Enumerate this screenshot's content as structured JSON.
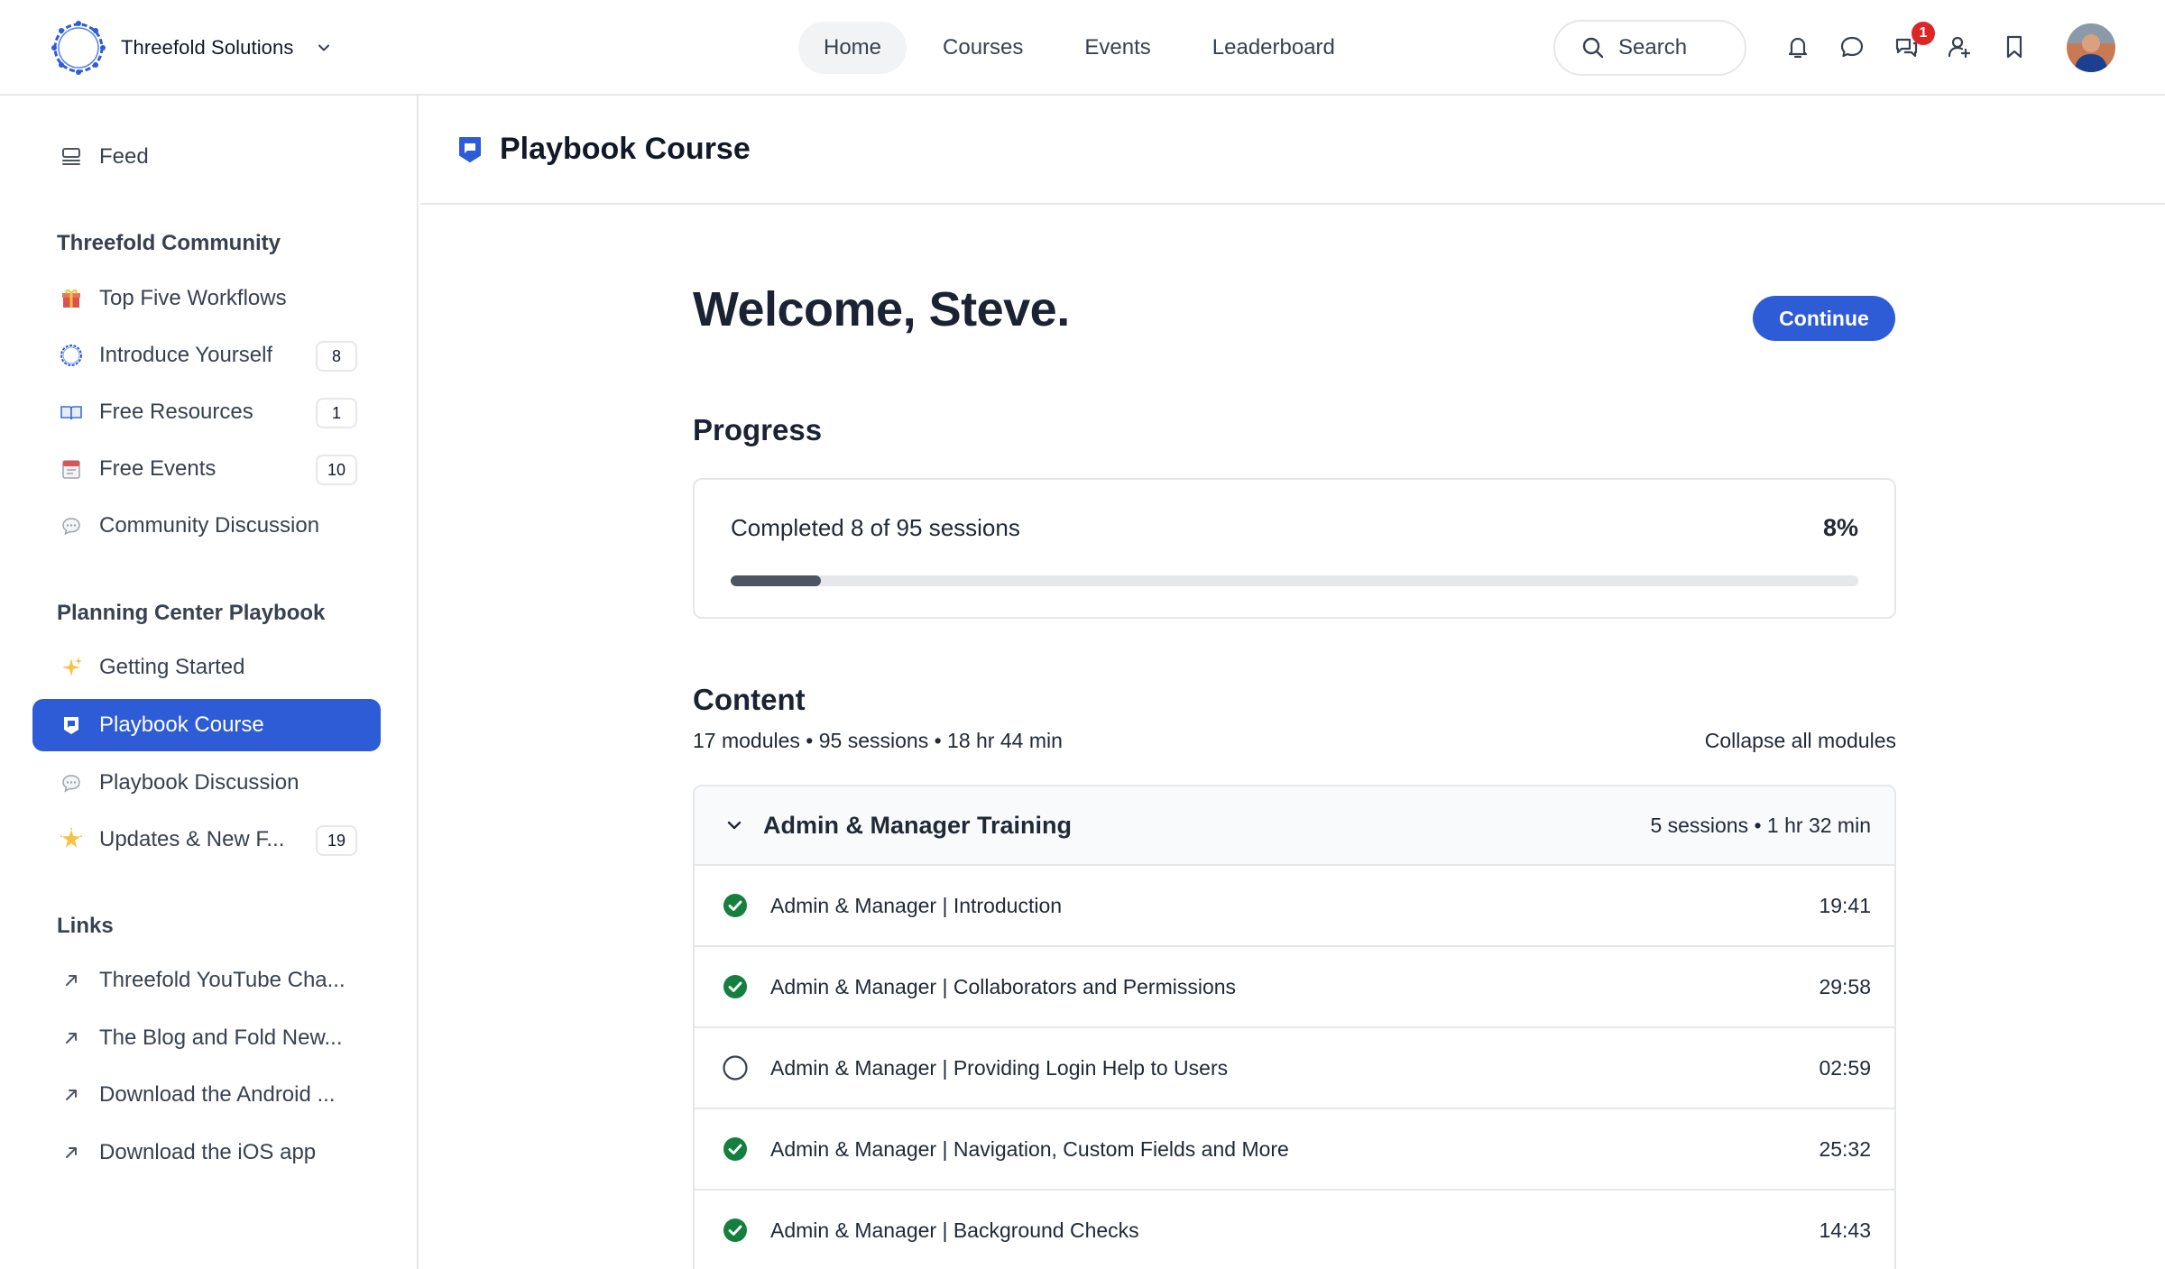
{
  "header": {
    "brand_name": "Threefold Solutions",
    "nav": [
      {
        "label": "Home",
        "active": true
      },
      {
        "label": "Courses",
        "active": false
      },
      {
        "label": "Events",
        "active": false
      },
      {
        "label": "Leaderboard",
        "active": false
      }
    ],
    "search_label": "Search",
    "icons": [
      "bell-icon",
      "chat-icon",
      "messages-icon",
      "people-icon",
      "bookmark-icon"
    ],
    "messages_badge": "1"
  },
  "sidebar": {
    "feed": "Feed",
    "sections": [
      {
        "heading": "Threefold Community",
        "items": [
          {
            "label": "Top Five Workflows",
            "icon": "gift-icon",
            "count": null
          },
          {
            "label": "Introduce Yourself",
            "icon": "threefold-logo-icon",
            "count": "8"
          },
          {
            "label": "Free Resources",
            "icon": "book-icon",
            "count": "1"
          },
          {
            "label": "Free Events",
            "icon": "calendar-icon",
            "count": "10"
          },
          {
            "label": "Community Discussion",
            "icon": "speech-bubble-icon",
            "count": null
          }
        ]
      },
      {
        "heading": "Planning Center Playbook",
        "items": [
          {
            "label": "Getting Started",
            "icon": "sparkles-icon",
            "count": null
          },
          {
            "label": "Playbook Course",
            "icon": "playbook-icon",
            "count": null,
            "active": true
          },
          {
            "label": "Playbook Discussion",
            "icon": "speech-bubble-icon",
            "count": null
          },
          {
            "label": "Updates & New F...",
            "icon": "star-burst-icon",
            "count": "19"
          }
        ]
      },
      {
        "heading": "Links",
        "items": [
          {
            "label": "Threefold YouTube Cha...",
            "icon": "external-arrow-icon"
          },
          {
            "label": "The Blog and Fold New...",
            "icon": "external-arrow-icon"
          },
          {
            "label": "Download the Android ...",
            "icon": "external-arrow-icon"
          },
          {
            "label": "Download the iOS app",
            "icon": "external-arrow-icon"
          }
        ]
      }
    ]
  },
  "main": {
    "page_title": "Playbook Course",
    "welcome": "Welcome, Steve.",
    "continue_label": "Continue",
    "progress": {
      "heading": "Progress",
      "text": "Completed 8 of 95 sessions",
      "percent_label": "8%",
      "fraction": 0.08
    },
    "content": {
      "heading": "Content",
      "meta": "17 modules • 95 sessions • 18 hr 44 min",
      "collapse_label": "Collapse all modules",
      "module": {
        "title": "Admin & Manager Training",
        "meta": "5 sessions • 1 hr 32 min",
        "sessions": [
          {
            "title": "Admin & Manager | Introduction",
            "time": "19:41",
            "completed": true
          },
          {
            "title": "Admin & Manager | Collaborators and Permissions",
            "time": "29:58",
            "completed": true
          },
          {
            "title": "Admin & Manager | Providing Login Help to Users",
            "time": "02:59",
            "completed": false
          },
          {
            "title": "Admin & Manager | Navigation, Custom Fields and More",
            "time": "25:32",
            "completed": true
          },
          {
            "title": "Admin & Manager | Background Checks",
            "time": "14:43",
            "completed": true
          }
        ]
      }
    }
  },
  "colors": {
    "accent": "#2e5bd6",
    "complete_green": "#15803d",
    "badge_red": "#dc2626",
    "progress_fill": "#4b5563"
  }
}
